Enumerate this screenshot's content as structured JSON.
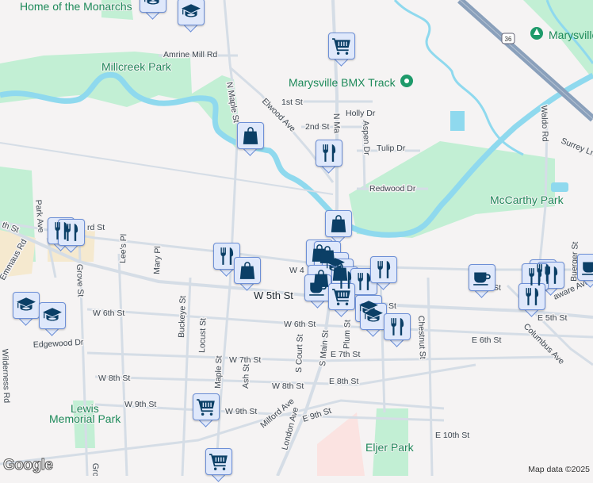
{
  "map": {
    "parks": [
      "Millcreek Park",
      "McCarthy Park",
      "Lewis",
      "Memorial Park",
      "Eljer Park",
      "Home of the Monarchs"
    ],
    "pois": [
      "Marysville BMX Track",
      "Marysville"
    ],
    "highway_shield": "36",
    "streets": {
      "amrine": "Amrine Mill Rd",
      "n_maple": "N Maple St",
      "elwood": "Elwood Ave",
      "first": "1st St",
      "holly": "Holly Dr",
      "second": "2nd St",
      "n_main": "N Ma",
      "aspen": "Aspen Dr",
      "tulip": "Tulip Dr",
      "redwood": "Redwood Dr",
      "waldo": "Waldo Rd",
      "surrey": "Surrey Ln",
      "park_ave": "Park Ave",
      "third": "rd St",
      "fifth_w": "th St",
      "emmaus": "Emmaus Rd",
      "grove": "Grove St",
      "lees": "Lee's Pl",
      "mary": "Mary Pl",
      "w5": "W 5th St",
      "w6": "W 6th St",
      "buckeye": "Buckeye St",
      "locust": "Locust St",
      "edgewood": "Edgewood Dr",
      "wilderness": "Wilderness Rd",
      "w7": "W 7th St",
      "w8": "W 8th St",
      "w9a": "W 9th St",
      "w9b": "W 9th St",
      "ash": "Ash St",
      "milford": "Milford Ave",
      "london": "London Ave",
      "s_maple": "Maple St",
      "s_court": "S Court St",
      "s_main": "S Main St",
      "s_plum": "S Plum St",
      "e7": "E 7th St",
      "e8": "E 8th St",
      "e9": "E 9th St",
      "e10": "E 10th St",
      "e6": "E 6th St",
      "e5": "E 5th St",
      "chestnut": "Chestnut St",
      "columbus": "Columbus Ave",
      "delaware": "aware Ave",
      "buerger": "Buerger St",
      "w4": "W 4",
      "st": "St",
      "grove2": "Gro"
    },
    "attribution": "Map data ©2025",
    "logo": "Google",
    "colors": {
      "water": "#8fd9ee",
      "park": "#c2efd4",
      "road": "#d5dde6",
      "marker_bg": "#dfe8fb",
      "marker_icon": "#0b3f66",
      "highway": "#8aa0bb"
    }
  }
}
